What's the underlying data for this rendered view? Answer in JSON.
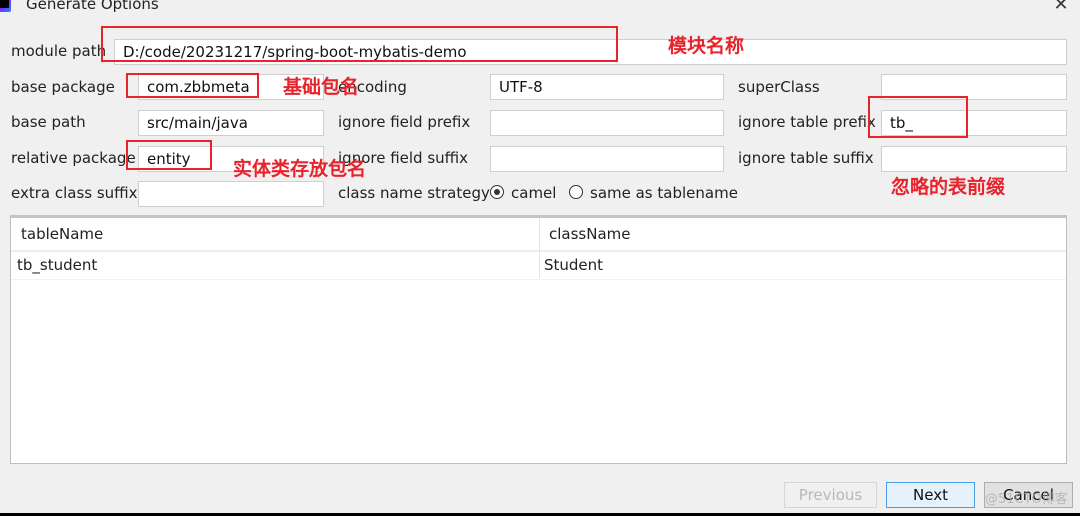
{
  "window": {
    "title": "Generate Options",
    "close_glyph": "✕"
  },
  "form": {
    "module_path": {
      "label": "module path",
      "value": "D:/code/20231217/spring-boot-mybatis-demo"
    },
    "base_package": {
      "label": "base package",
      "value": "com.zbbmeta"
    },
    "encoding": {
      "label": "encoding",
      "value": "UTF-8"
    },
    "super_class": {
      "label": "superClass",
      "value": ""
    },
    "base_path": {
      "label": "base path",
      "value": "src/main/java"
    },
    "ignore_field_prefix": {
      "label": "ignore field prefix",
      "value": ""
    },
    "ignore_table_prefix": {
      "label": "ignore table prefix",
      "value": "tb_"
    },
    "relative_package": {
      "label": "relative package",
      "value": "entity"
    },
    "ignore_field_suffix": {
      "label": "ignore field suffix",
      "value": ""
    },
    "ignore_table_suffix": {
      "label": "ignore table suffix",
      "value": ""
    },
    "extra_class_suffix": {
      "label": "extra class suffix",
      "value": ""
    },
    "class_name_strategy": {
      "label": "class name strategy",
      "options": [
        {
          "label": "camel",
          "selected": true
        },
        {
          "label": "same as tablename",
          "selected": false
        }
      ]
    }
  },
  "table": {
    "columns": [
      "tableName",
      "className"
    ],
    "rows": [
      [
        "tb_student",
        "Student"
      ]
    ]
  },
  "buttons": {
    "previous": {
      "label": "Previous",
      "enabled": false
    },
    "next": {
      "label": "Next",
      "enabled": true
    },
    "cancel": {
      "label": "Cancel",
      "enabled": true
    }
  },
  "annotations": {
    "module_name": "模块名称",
    "base_package": "基础包名",
    "entity_package": "实体类存放包名",
    "ignored_table_prefix": "忽略的表前缀",
    "color": "#e8232b"
  },
  "watermark": "@51CTO博客"
}
